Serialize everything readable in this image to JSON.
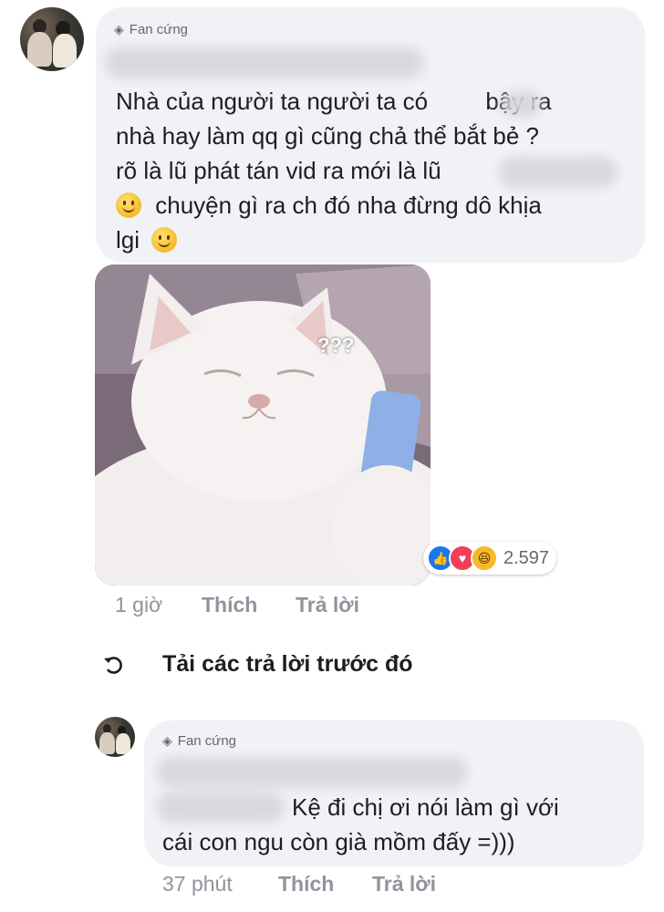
{
  "comment1": {
    "badge": "Fan cứng",
    "lines": [
      "Nhà của người ta người ta có",
      "bậy ra",
      "nhà hay làm qq gì cũng chả thể bắt bẻ ?",
      "rõ là lũ phát tán vid ra mới là lũ",
      "chuyện gì ra ch đó nha đừng dô khịa",
      "lgi"
    ],
    "sticker_text": "???",
    "reactions": {
      "count": "2.597",
      "icons": [
        "like-icon",
        "love-icon",
        "haha-icon"
      ]
    },
    "time": "1 giờ",
    "like": "Thích",
    "reply": "Trả lời"
  },
  "load_previous": "Tải các trả lời trước đó",
  "comment2": {
    "badge": "Fan cứng",
    "line1": "Kệ đi chị ơi nói làm gì với",
    "line2": "cái con ngu còn già mồm đấy =)))",
    "time": "37 phút",
    "like": "Thích",
    "reply": "Trả lời"
  }
}
